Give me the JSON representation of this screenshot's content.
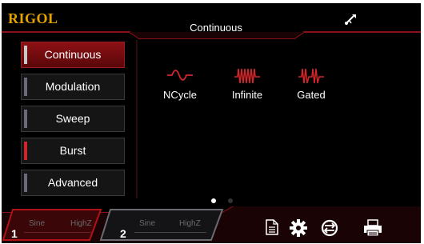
{
  "header": {
    "logo": "RIGOL",
    "mode_title": "Continuous"
  },
  "menu": {
    "items": [
      {
        "label": "Continuous"
      },
      {
        "label": "Modulation"
      },
      {
        "label": "Sweep"
      },
      {
        "label": "Burst"
      },
      {
        "label": "Advanced"
      }
    ],
    "selected": "Continuous"
  },
  "burst_types": [
    {
      "label": "NCycle",
      "icon": "ncycle-wave-icon"
    },
    {
      "label": "Infinite",
      "icon": "infinite-burst-icon"
    },
    {
      "label": "Gated",
      "icon": "gated-burst-icon"
    }
  ],
  "pager": {
    "current_page": 1,
    "total_pages": 2
  },
  "channels": [
    {
      "number": "1",
      "waveform": "Sine",
      "impedance": "HighZ"
    },
    {
      "number": "2",
      "waveform": "Sine",
      "impedance": "HighZ"
    }
  ],
  "toolbar_icons": [
    "file-icon",
    "gear-icon",
    "sync-icon",
    "print-icon"
  ],
  "colors": {
    "accent_red": "#b01218",
    "logo_orange": "#e5a200",
    "background": "#000000"
  }
}
